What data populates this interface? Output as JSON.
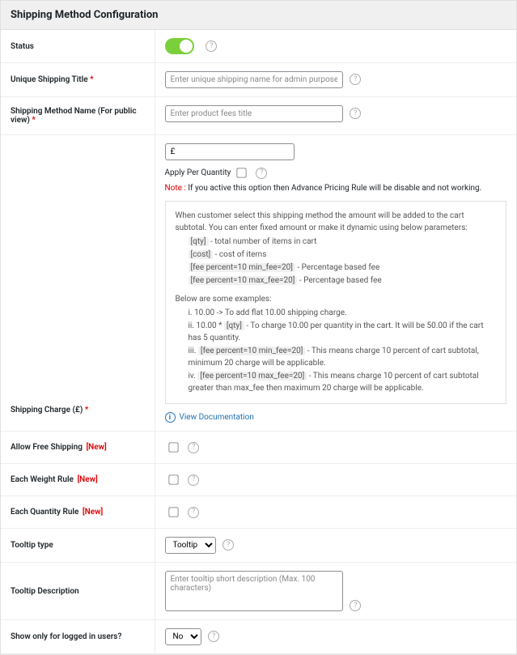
{
  "page_title": "Shipping Method Configuration",
  "labels": {
    "status": "Status",
    "unique_title": "Unique Shipping Title",
    "method_name": "Shipping Method Name (For public view)",
    "charge": "Shipping Charge (£)",
    "allow_free": "Allow Free Shipping",
    "weight_rule": "Each Weight Rule",
    "qty_rule": "Each Quantity Rule",
    "tooltip_type": "Tooltip type",
    "tooltip_desc": "Tooltip Description",
    "logged_in": "Show only for logged in users?"
  },
  "tags": {
    "new": "[New]"
  },
  "placeholders": {
    "unique_title": "Enter unique shipping name for admin purpose",
    "method_name": "Enter product fees title",
    "tooltip_desc": "Enter tooltip short description (Max. 100 characters)"
  },
  "values": {
    "charge_prefix": "£",
    "tooltip_type_selected": "Tooltip",
    "logged_in_selected": "No"
  },
  "apply_qty": {
    "label": "Apply Per Quantity",
    "note_label": "Note :",
    "note_text": "If you active this option then Advance Pricing Rule will be disable and not working."
  },
  "desc": {
    "intro": "When customer select this shipping method the amount will be added to the cart subtotal. You can enter fixed amount or make it dynamic using below parameters:",
    "params": [
      {
        "code": "[qty]",
        "text": "- total number of items in cart"
      },
      {
        "code": "[cost]",
        "text": "- cost of items"
      },
      {
        "code": "[fee percent=10 min_fee=20]",
        "text": "- Percentage based fee"
      },
      {
        "code": "[fee percent=10 max_fee=20]",
        "text": "- Percentage based fee"
      }
    ],
    "examples_intro": "Below are some examples:",
    "examples": [
      {
        "n": "i.",
        "pre": "10.00 -> To add flat 10.00 shipping charge."
      },
      {
        "n": "ii.",
        "pre": "10.00 *",
        "code": "[qty]",
        "post": "- To charge 10.00 per quantity in the cart. It will be 50.00 if the cart has 5 quantity."
      },
      {
        "n": "iii.",
        "code": "[fee percent=10 min_fee=20]",
        "post": "- This means charge 10 percent of cart subtotal, minimum 20 charge will be applicable."
      },
      {
        "n": "iv.",
        "code": "[fee percent=10 max_fee=20]",
        "post": "- This means charge 10 percent of cart subtotal greater than max_fee then maximum 20 charge will be applicable."
      }
    ],
    "doc_link": "View Documentation"
  }
}
